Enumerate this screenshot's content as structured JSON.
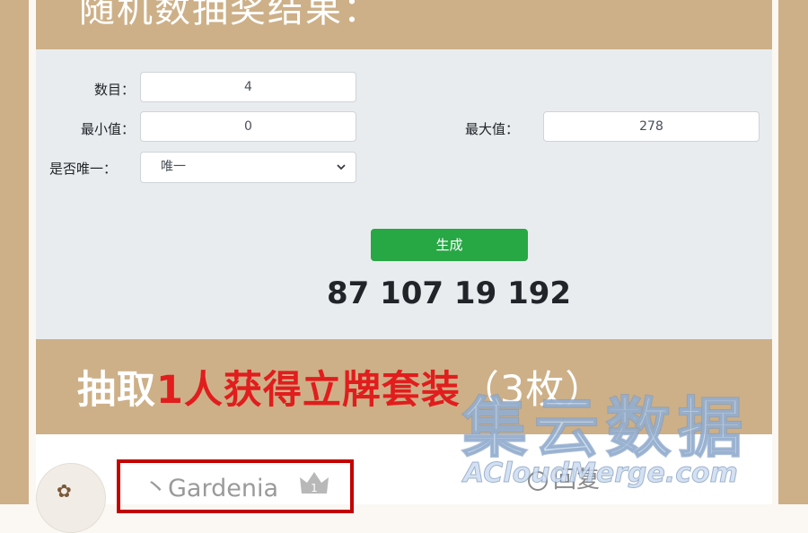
{
  "top_banner": {
    "title": "随机数抽奖结果："
  },
  "form": {
    "count_label": "数目：",
    "count_value": "4",
    "min_label": "最小值：",
    "min_value": "0",
    "max_label": "最大值：",
    "max_value": "278",
    "unique_label": "是否唯一：",
    "unique_value": "唯一"
  },
  "generate_button": "生成",
  "result": "87 107 19 192",
  "section_title": {
    "prefix": "抽取",
    "highlight": "1人获得立牌套装",
    "suffix": "（3枚）"
  },
  "comment": {
    "username": "丶Gardenia",
    "badge_number": "1",
    "reply_label": "回复"
  },
  "watermark": {
    "main": "集云数据",
    "sub": "ACloudMerge.com"
  },
  "colors": {
    "banner": "#cdb088",
    "panel": "#e9ecef",
    "button": "#28a745",
    "highlight": "#e11d1d"
  }
}
